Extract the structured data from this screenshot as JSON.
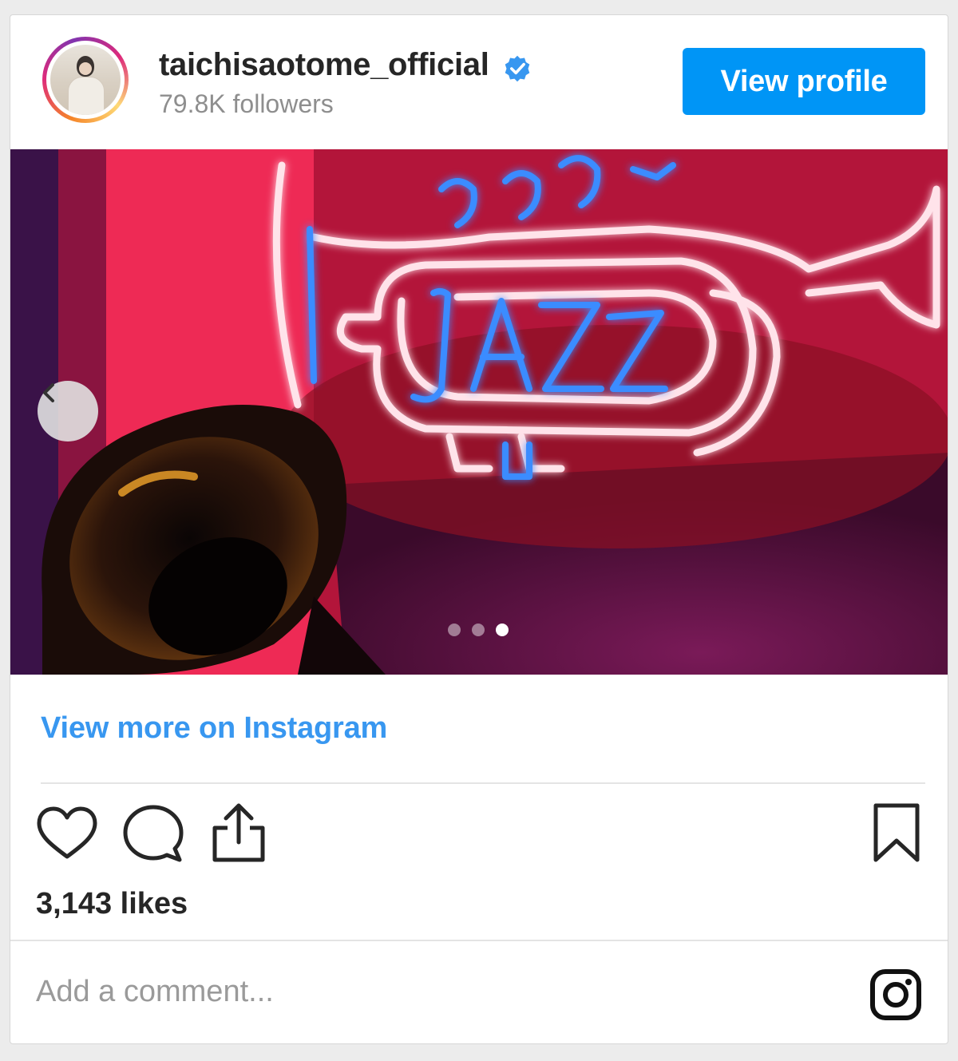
{
  "header": {
    "username": "taichisaotome_official",
    "followers": "79.8K followers",
    "view_profile_label": "View profile"
  },
  "media": {
    "neon_text": "JAZZ",
    "carousel_index": 3,
    "carousel_total": 3
  },
  "links": {
    "view_more": "View more on Instagram"
  },
  "engagement": {
    "likes": "3,143 likes"
  },
  "comment": {
    "placeholder": "Add a comment..."
  },
  "icons": [
    "verified-badge-icon",
    "chevron-left-icon",
    "heart-icon",
    "comment-icon",
    "share-icon",
    "bookmark-icon",
    "instagram-logo-icon"
  ],
  "colors": {
    "accent": "#0095f6",
    "link": "#3897f0",
    "text": "#262626",
    "muted": "#8e8e8e"
  }
}
